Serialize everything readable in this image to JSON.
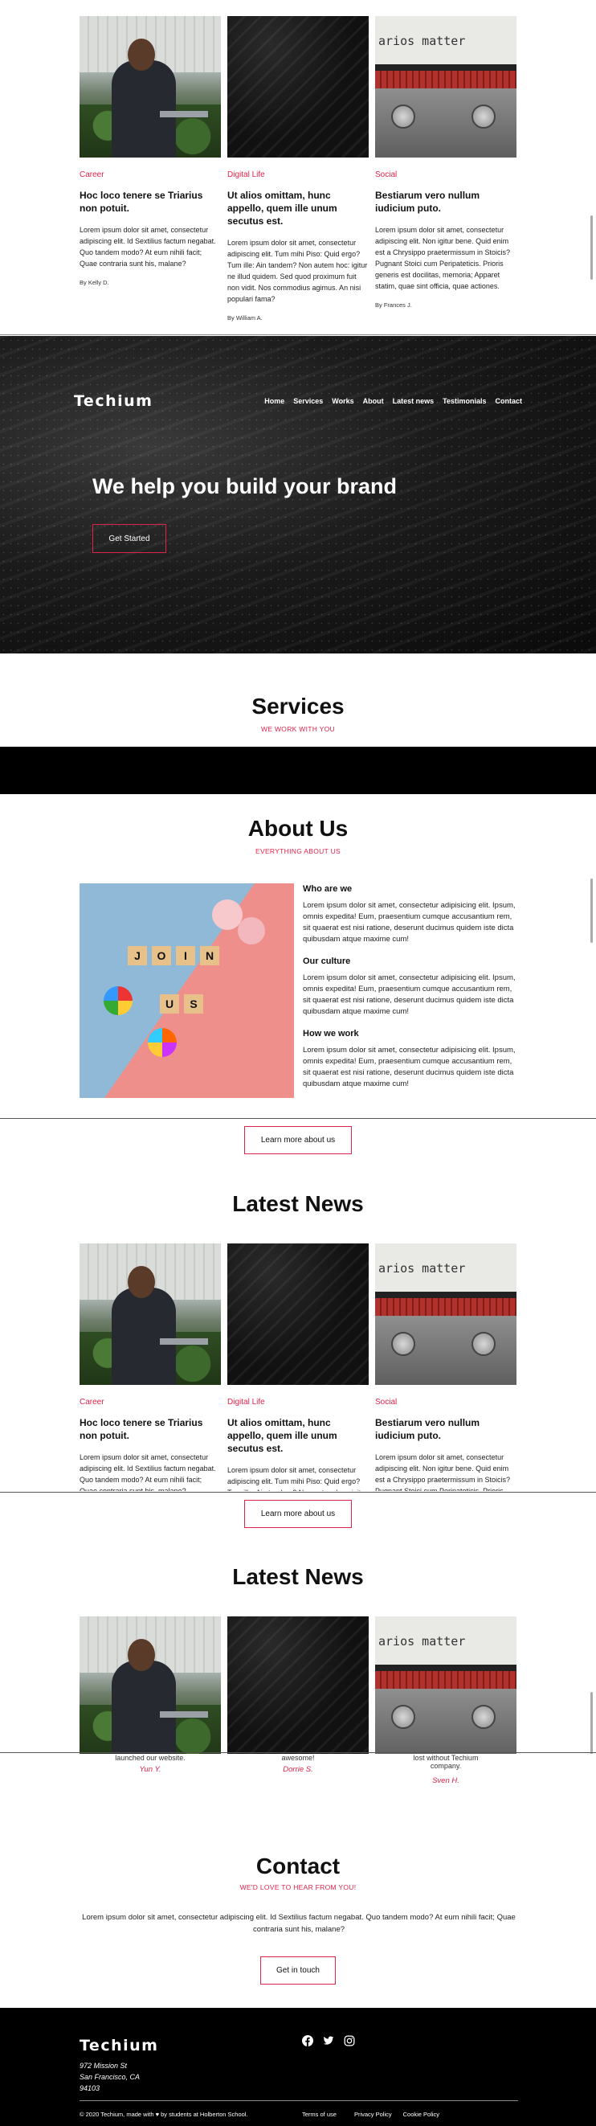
{
  "news_cards": [
    {
      "category": "Career",
      "title": "Hoc loco tenere se Triarius non potuit.",
      "body": "Lorem ipsum dolor sit amet, consectetur adipiscing elit. Id Sextilius factum negabat. Quo tandem modo? At eum nihili facit; Quae contraria sunt his, malane?",
      "author": "By Kelly D."
    },
    {
      "category": "Digital Life",
      "title": "Ut alios omittam, hunc appello, quem ille unum secutus est.",
      "body": "Lorem ipsum dolor sit amet, consectetur adipiscing elit. Tum mihi Piso: Quid ergo? Tum ille: Ain tandem? Non autem hoc: igitur ne illud quidem. Sed quod proximum fuit non vidit. Nos commodius agimus. An nisi populari fama?",
      "author": "By William A."
    },
    {
      "category": "Social",
      "title": "Bestiarum vero nullum iudicium puto.",
      "body": "Lorem ipsum dolor sit amet, consectetur adipiscing elit. Non igitur bene. Quid enim est a Chrysippo praetermissum in Stoicis? Pugnant Stoici cum Peripateticis. Prioris generis est docilitas, memoria; Apparet statim, quae sint officia, quae actiones.",
      "author": "By Frances J."
    }
  ],
  "typewriter_text": "arios matter",
  "header": {
    "logo": "Techium",
    "nav": [
      "Home",
      "Services",
      "Works",
      "About",
      "Latest news",
      "Testimonials",
      "Contact"
    ],
    "headline": "We help you build your brand",
    "cta": "Get Started"
  },
  "services": {
    "title": "Services",
    "subtitle": "WE WORK WITH YOU"
  },
  "about": {
    "title": "About Us",
    "subtitle": "EVERYTHING ABOUT US",
    "tiles": [
      "J",
      "O",
      "I",
      "N",
      "U",
      "S"
    ],
    "blocks": [
      {
        "heading": "Who are we",
        "text": "Lorem ipsum dolor sit amet, consectetur adipisicing elit. Ipsum, omnis expedita! Eum, praesentium cumque accusantium rem, sit quaerat est nisi ratione, deserunt ducimus quidem iste dicta quibusdam atque maxime cum!"
      },
      {
        "heading": "Our culture",
        "text": "Lorem ipsum dolor sit amet, consectetur adipisicing elit. Ipsum, omnis expedita! Eum, praesentium cumque accusantium rem, sit quaerat est nisi ratione, deserunt ducimus quidem iste dicta quibusdam atque maxime cum!"
      },
      {
        "heading": "How we work",
        "text": "Lorem ipsum dolor sit amet, consectetur adipisicing elit. Ipsum, omnis expedita! Eum, praesentium cumque accusantium rem, sit quaerat est nisi ratione, deserunt ducimus quidem iste dicta quibusdam atque maxime cum!"
      }
    ],
    "button": "Learn more about us"
  },
  "latest1": {
    "title": "Latest News",
    "button": "Learn more about us"
  },
  "latest2": {
    "title": "Latest News"
  },
  "testimonials": [
    {
      "text": "launched our website.",
      "name": "Yun Y."
    },
    {
      "text": "awesome!",
      "name": "Dorrie S."
    },
    {
      "text": "lost without Techium company.",
      "name": "Sven H."
    }
  ],
  "contact": {
    "title": "Contact",
    "subtitle": "WE'D LOVE TO HEAR FROM YOU!",
    "text": "Lorem ipsum dolor sit amet, consectetur adipiscing elit. Id Sextilius factum negabat. Quo tandem modo? At eum nihili facit; Quae contraria sunt his, malane?",
    "button": "Get in touch"
  },
  "footer": {
    "logo": "Techium",
    "address1": "972 Mission St",
    "address2": "San Francisco, CA",
    "address3": "94103",
    "credit": "© 2020 Techium, made with ♥ by students at Holberton School.",
    "links": [
      "Terms of use",
      "Privacy Policy",
      "Cookie Policy"
    ]
  },
  "colors": {
    "accent": "#e0234b",
    "dark": "#000000"
  }
}
